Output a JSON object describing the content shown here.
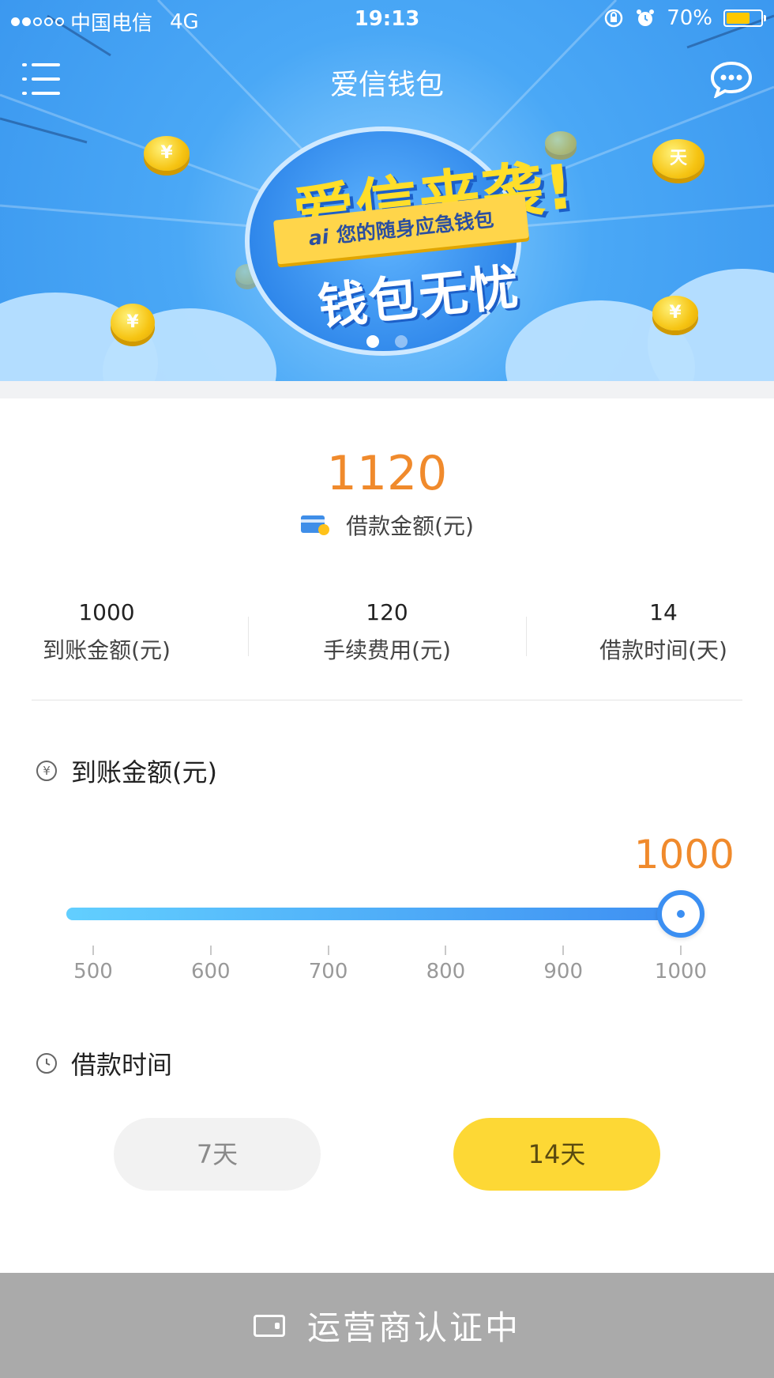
{
  "status_bar": {
    "carrier": "中国电信",
    "network": "4G",
    "time": "19:13",
    "battery": "70%",
    "battery_level": 0.7
  },
  "header": {
    "title": "爱信钱包",
    "menu_icon": "hamburger-menu-icon",
    "chat_icon": "chat-bubble-icon"
  },
  "banner": {
    "headline_1": "爱信来袭!",
    "ribbon_logo": "ai",
    "ribbon_text": "您的随身应急钱包",
    "headline_2": "钱包无忧",
    "coin_marks": [
      "¥",
      "天",
      "¥",
      "¥"
    ],
    "page_count": 2,
    "active_page": 1
  },
  "loan": {
    "total_amount": "1120",
    "total_label": "借款金额(元)",
    "stats": [
      {
        "value": "1000",
        "label": "到账金额(元)"
      },
      {
        "value": "120",
        "label": "手续费用(元)"
      },
      {
        "value": "14",
        "label": "借款时间(天)"
      }
    ]
  },
  "amount_section": {
    "title": "到账金额(元)",
    "icon": "yuan-circle-icon",
    "current_value": "1000",
    "slider": {
      "min": 500,
      "max": 1000,
      "value": 1000,
      "ticks": [
        "500",
        "600",
        "700",
        "800",
        "900",
        "1000"
      ]
    }
  },
  "term_section": {
    "title": "借款时间",
    "icon": "clock-icon",
    "options": [
      {
        "label": "7天",
        "selected": false
      },
      {
        "label": "14天",
        "selected": true
      }
    ]
  },
  "bottom_button": {
    "label": "运营商认证中",
    "icon": "wallet-icon"
  },
  "colors": {
    "accent_orange": "#f08a2c",
    "primary_blue": "#3b8ff2",
    "selected_yellow": "#fdd835",
    "bottom_bar_gray": "#aaaaaa"
  }
}
